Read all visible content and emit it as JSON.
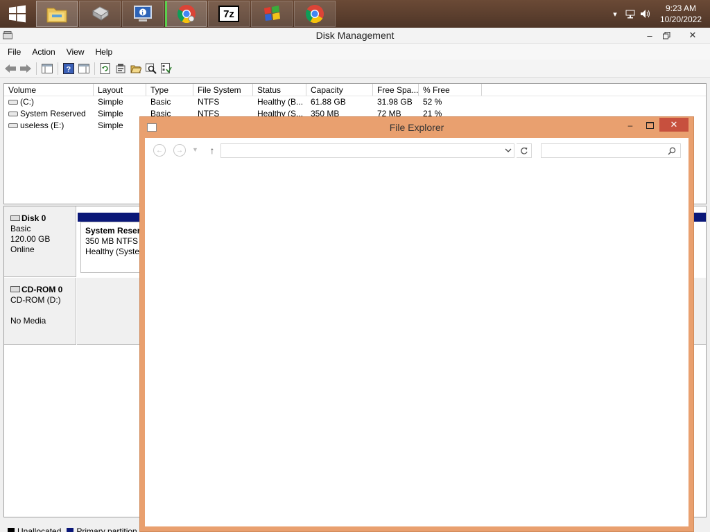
{
  "taskbar": {
    "apps": [
      {
        "name": "File Explorer"
      },
      {
        "name": "Removable drive"
      },
      {
        "name": "System information"
      },
      {
        "name": "Google Chrome",
        "running": true
      },
      {
        "name": "7-Zip",
        "label": "7z"
      },
      {
        "name": "Windows legacy app"
      },
      {
        "name": "Google Chrome"
      }
    ],
    "clock": {
      "time": "9:23 AM",
      "date": "10/20/2022"
    }
  },
  "disk_management": {
    "title": "Disk Management",
    "menu": [
      "File",
      "Action",
      "View",
      "Help"
    ],
    "columns": [
      "Volume",
      "Layout",
      "Type",
      "File System",
      "Status",
      "Capacity",
      "Free Spa...",
      "% Free"
    ],
    "volumes": [
      [
        "(C:)",
        "Simple",
        "Basic",
        "NTFS",
        "Healthy (B...",
        "61.88 GB",
        "31.98 GB",
        "52 %"
      ],
      [
        "System Reserved",
        "Simple",
        "Basic",
        "NTFS",
        "Healthy (S...",
        "350 MB",
        "72 MB",
        "21 %"
      ],
      [
        "useless (E:)",
        "Simple",
        "",
        "",
        "",
        "",
        "",
        ""
      ]
    ],
    "disks": [
      {
        "name": "Disk 0",
        "type": "Basic",
        "size": "120.00 GB",
        "state": "Online",
        "partition": {
          "name": "System Reserv",
          "size": "350 MB NTFS",
          "status": "Healthy (System"
        }
      },
      {
        "name": "CD-ROM 0",
        "type": "CD-ROM (D:)",
        "state": "No Media"
      }
    ],
    "legend": [
      {
        "label": "Unallocated",
        "color": "#000000"
      },
      {
        "label": "Primary partition",
        "color": "#0a1778"
      }
    ]
  },
  "file_explorer": {
    "title": "File Explorer",
    "address": "",
    "search_placeholder": ""
  },
  "colors": {
    "explorer_frame": "#e9a06f",
    "close_button": "#c7503e",
    "taskbar": "#5a3e2e",
    "partition_primary": "#0a1778"
  }
}
